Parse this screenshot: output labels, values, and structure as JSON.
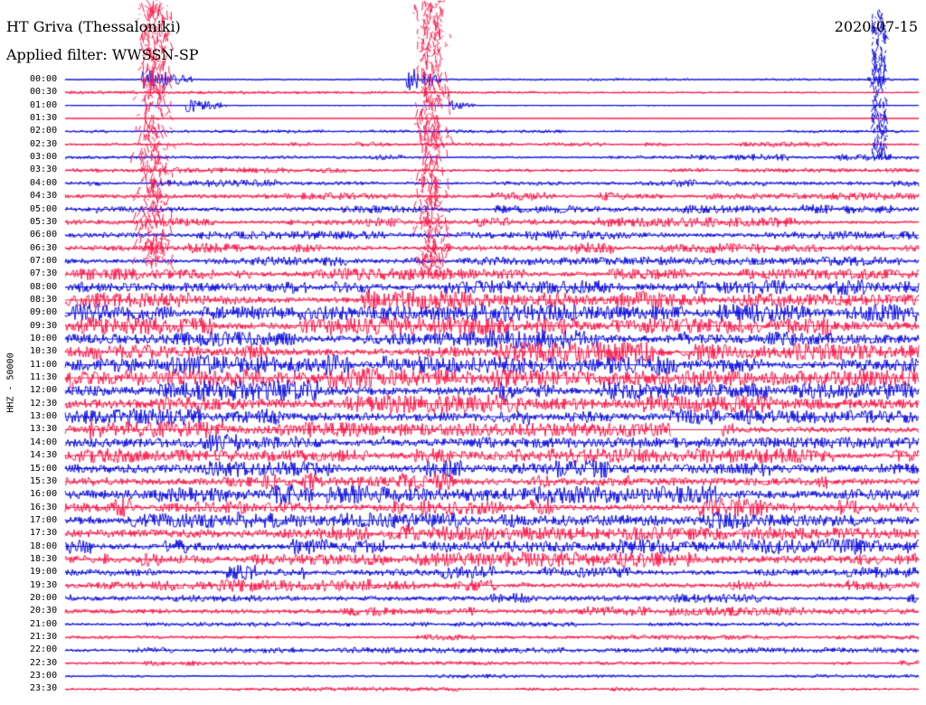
{
  "header": {
    "station": "HT Griva (Thessaloniki)",
    "filter": "Applied filter: WWSSN-SP",
    "date": "2020-07-15"
  },
  "chart_data": {
    "type": "helicorder",
    "ylabel": "HHZ - 50000",
    "row_labels": [
      "00:00",
      "00:30",
      "01:00",
      "01:30",
      "02:00",
      "02:30",
      "03:00",
      "03:30",
      "04:00",
      "04:30",
      "05:00",
      "05:30",
      "06:00",
      "06:30",
      "07:00",
      "07:30",
      "08:00",
      "08:30",
      "09:00",
      "09:30",
      "10:00",
      "10:30",
      "11:00",
      "11:30",
      "12:00",
      "12:30",
      "13:00",
      "13:30",
      "14:00",
      "14:30",
      "15:00",
      "15:30",
      "16:00",
      "16:30",
      "17:00",
      "17:30",
      "18:00",
      "18:30",
      "19:00",
      "19:30",
      "20:00",
      "20:30",
      "21:00",
      "21:30",
      "22:00",
      "22:30",
      "23:00",
      "23:30"
    ],
    "trace_colors": [
      "#1010e0",
      "#ff1a4a"
    ],
    "noise_level": [
      0.25,
      0.08,
      0.06,
      0.06,
      0.3,
      0.4,
      0.55,
      0.45,
      0.6,
      0.7,
      0.75,
      0.8,
      0.85,
      0.9,
      0.95,
      1.0,
      1.3,
      1.5,
      1.6,
      1.6,
      1.7,
      1.8,
      1.9,
      1.8,
      1.7,
      1.6,
      1.6,
      1.5,
      1.5,
      1.4,
      1.5,
      1.5,
      1.6,
      1.6,
      1.5,
      1.4,
      1.4,
      1.3,
      1.2,
      1.0,
      0.9,
      0.8,
      0.4,
      0.5,
      0.5,
      0.45,
      0.35,
      0.35
    ],
    "events": [
      {
        "row": 0,
        "position": 0.09,
        "length": 0.06,
        "amplitude": 12
      },
      {
        "row": 0,
        "position": 0.4,
        "length": 0.04,
        "amplitude": 14
      },
      {
        "row": 0,
        "position": 0.94,
        "length": 0.03,
        "amplitude": 6
      },
      {
        "row": 1,
        "position": 0.0,
        "length": 1.0,
        "amplitude": 2
      },
      {
        "row": 2,
        "position": 0.14,
        "length": 0.05,
        "amplitude": 8
      },
      {
        "row": 2,
        "position": 0.45,
        "length": 0.03,
        "amplitude": 6
      }
    ],
    "gap": {
      "row": 27,
      "start": 0.71,
      "end": 0.77
    }
  }
}
